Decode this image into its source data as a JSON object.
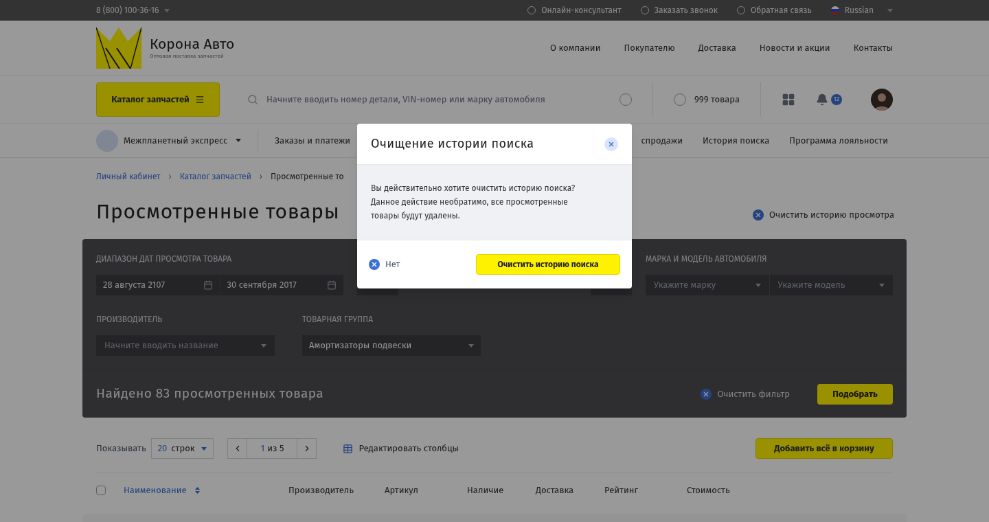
{
  "top_bar": {
    "phone": "8 (800) 100-36-16",
    "links": [
      {
        "label": "Онлайн-консультант"
      },
      {
        "label": "Заказать звонок"
      },
      {
        "label": "Обратная связь"
      }
    ],
    "language": "Russian"
  },
  "header": {
    "logo": {
      "name": "Корона Авто",
      "tagline": "Оптовая поставка запчастей"
    },
    "nav": [
      "О компании",
      "Покупателю",
      "Доставка",
      "Новости и акции",
      "Контакты"
    ]
  },
  "toolbar": {
    "catalog_button": "Каталог запчастей",
    "search": {
      "placeholder": "Начните вводить номер детали, VIN-номер или марку автомобиля"
    },
    "cart": "999 товара",
    "notifications": "12"
  },
  "subnav": {
    "account": "Межпланетный экспресс",
    "left_items": [
      "Заказы и платежи"
    ],
    "right_items": [
      "спродажи",
      "История поиска",
      "Программа лояльности"
    ]
  },
  "breadcrumb_separator": "›",
  "breadcrumbs": [
    {
      "label": "Личный кабинет",
      "link": true
    },
    {
      "label": "Каталог запчастей",
      "link": true
    },
    {
      "label": "Просмотренные то",
      "link": false
    }
  ],
  "page_title": "Просмотренные товары",
  "clear_history": "Очистить историю просмотра",
  "filters": {
    "date_range": {
      "label": "ДИАПАЗОН ДАТ ПРОСМОТРА ТОВАРА",
      "from": "28 августа 2107",
      "to": "30 сентября 2017"
    },
    "make_model": {
      "label": "МАРКА И МОДЕЛЬ АВТОМОБИЛЯ",
      "make_placeholder": "Укажите марку",
      "model_placeholder": "Укажите модель"
    },
    "manufacturer": {
      "label": "ПРОИЗВОДИТЕЛЬ",
      "placeholder": "Начните вводить название"
    },
    "product_group": {
      "label": "ТОВАРНАЯ ГРУППА",
      "value": "Амортизаторы подвески"
    },
    "found": "Найдено 83 просмотренных товара",
    "clear_filter": "Очистить фильтр",
    "apply": "Подобрать"
  },
  "table_toolbar": {
    "show_label": "Показывать",
    "rows_count": "20",
    "rows_unit": "строк",
    "page": "1",
    "page_total": "из 5",
    "edit_columns": "Редактировать столбцы",
    "add_all": "Добавить всё в корзину"
  },
  "table": {
    "select_all": {
      "checked": false
    },
    "columns": [
      {
        "label": "Наименование",
        "sortable": true
      },
      {
        "label": "Производитель",
        "sortable": false
      },
      {
        "label": "Артикул",
        "sortable": false
      },
      {
        "label": "Наличие",
        "sortable": false
      },
      {
        "label": "Доставка",
        "sortable": false
      },
      {
        "label": "Рейтинг",
        "sortable": false
      },
      {
        "label": "Стоимость",
        "sortable": false
      }
    ]
  },
  "modal": {
    "title": "Очищение истории поиска",
    "message": "Вы действительно хотите очистить историю поиска? Данное действие необратимо, все просмотренные товары будут удалены.",
    "cancel": "Нет",
    "confirm": "Очистить историю поиска"
  }
}
